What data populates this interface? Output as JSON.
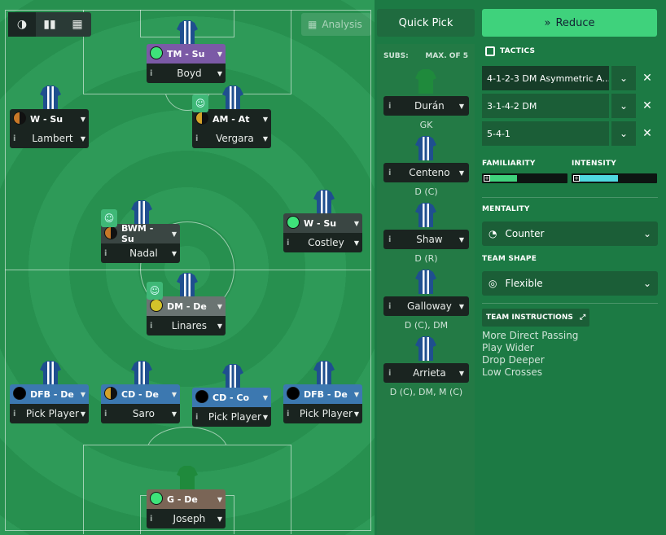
{
  "view_toggle": {
    "icons": [
      "contrast-icon",
      "bar-chart-icon",
      "calendar-icon"
    ]
  },
  "analysis": {
    "label": "Analysis"
  },
  "quick_pick": {
    "label": "Quick Pick"
  },
  "reduce": {
    "label": "Reduce"
  },
  "pitch_players": [
    {
      "role": "TM - Su",
      "name": "Boyd",
      "color": "#7b5aa6",
      "dot": "#3ee37a"
    },
    {
      "role": "W - Su",
      "name": "Lambert",
      "color": "#1a2420",
      "dot": "half-orange"
    },
    {
      "role": "AM - At",
      "name": "Vergara",
      "color": "#1a2420",
      "dot": "half-gold"
    },
    {
      "role": "BWM - Su",
      "name": "Nadal",
      "color": "#3a4643",
      "dot": "half-orange"
    },
    {
      "role": "W - Su",
      "name": "Costley",
      "color": "#3a4643",
      "dot": "#3ee37a"
    },
    {
      "role": "DM - De",
      "name": "Linares",
      "color": "#6a7472",
      "dot": "#d4c32a"
    },
    {
      "role": "DFB - De",
      "name": "Pick Player",
      "color": "#3c78b0",
      "dot": "#000"
    },
    {
      "role": "CD - De",
      "name": "Saro",
      "color": "#3c78b0",
      "dot": "half-gold"
    },
    {
      "role": "CD - Co",
      "name": "Pick Player",
      "color": "#3c78b0",
      "dot": "#000"
    },
    {
      "role": "DFB - De",
      "name": "Pick Player",
      "color": "#3c78b0",
      "dot": "#000"
    },
    {
      "role": "G - De",
      "name": "Joseph",
      "color": "#7a6556",
      "dot": "#3ee37a"
    }
  ],
  "subs": {
    "title": "SUBS:",
    "max": "MAX. OF 5",
    "players": [
      {
        "name": "Durán",
        "pos": "GK"
      },
      {
        "name": "Centeno",
        "pos": "D (C)"
      },
      {
        "name": "Shaw",
        "pos": "D (R)"
      },
      {
        "name": "Galloway",
        "pos": "D (C), DM"
      },
      {
        "name": "Arrieta",
        "pos": "D (C), DM, M (C)"
      }
    ]
  },
  "tactics": {
    "label": "TACTICS",
    "items": [
      "4-1-2-3 DM Asymmetric A...",
      "3-1-4-2 DM",
      "5-4-1"
    ]
  },
  "familiarity": {
    "label": "FAMILIARITY",
    "value": 0.35,
    "color": "#3fd27c"
  },
  "intensity": {
    "label": "INTENSITY",
    "value": 0.5,
    "color": "#4fd8e0"
  },
  "mentality": {
    "label": "MENTALITY",
    "value": "Counter"
  },
  "team_shape": {
    "label": "TEAM SHAPE",
    "value": "Flexible"
  },
  "team_instructions": {
    "label": "TEAM INSTRUCTIONS",
    "items": [
      "More Direct Passing",
      "Play Wider",
      "Drop Deeper",
      "Low Crosses"
    ]
  }
}
